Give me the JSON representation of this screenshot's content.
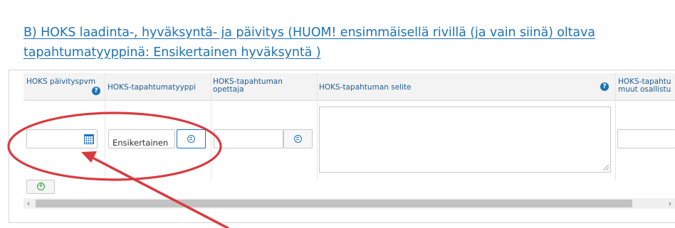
{
  "section": {
    "title": "B) HOKS laadinta-, hyväksyntä- ja päivitys (HUOM! ensimmäisellä rivillä (ja vain siinä) oltava tapahtumatyyppinä: Ensikertainen hyväksyntä )"
  },
  "grid": {
    "columns": [
      "HOKS päivityspvm",
      "HOKS-tapahtumatyyppi",
      "HOKS-tapahtuman opettaja",
      "HOKS-tapahtuman selite",
      "HOKS-tapahtu muut osallistu"
    ],
    "help_glyph": "?",
    "row": {
      "date_value": "",
      "event_type_value": "Ensikertainen",
      "teacher_value": "",
      "description_value": "",
      "other_participants_value": ""
    }
  },
  "add_row_glyph": "+",
  "scroll": {
    "left_arrow": "‹",
    "right_arrow": "›"
  },
  "annotation": {
    "shape": "ellipse-and-arrow",
    "color": "#d93a3f"
  }
}
